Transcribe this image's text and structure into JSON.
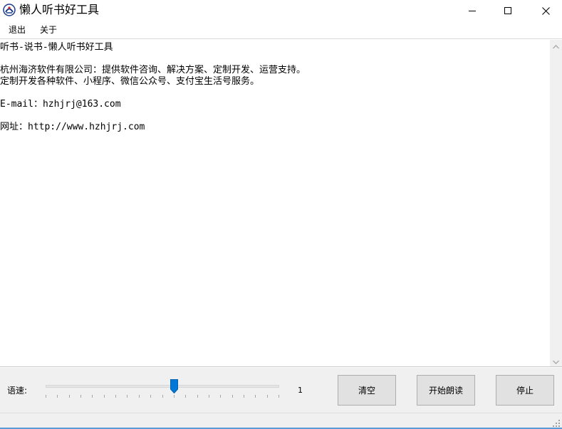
{
  "window": {
    "title": "懒人听书好工具",
    "icon": "app-logo-icon",
    "controls": {
      "minimize_icon": "minimize-icon",
      "maximize_icon": "maximize-icon",
      "close_icon": "close-icon"
    }
  },
  "menu": {
    "items": [
      {
        "label": "退出"
      },
      {
        "label": "关于"
      }
    ]
  },
  "content": {
    "lines": [
      "听书-说书-懒人听书好工具",
      "",
      "杭州海济软件有限公司：提供软件咨询、解决方案、定制开发、运营支持。",
      "定制开发各种软件、小程序、微信公众号、支付宝生活号服务。",
      "",
      "E-mail：hzhjrj@163.com",
      "",
      "网址：http://www.hzhjrj.com"
    ]
  },
  "controls": {
    "speed_label": "语速:",
    "speed_value": "1",
    "speed_fraction": 0.55,
    "tick_count": 21,
    "clear_label": "清空",
    "start_label": "开始朗读",
    "stop_label": "停止"
  },
  "colors": {
    "accent": "#0078d7",
    "button_bg": "#e1e1e1",
    "panel_bg": "#f0f0f0",
    "window_border": "#5b9bd5"
  }
}
